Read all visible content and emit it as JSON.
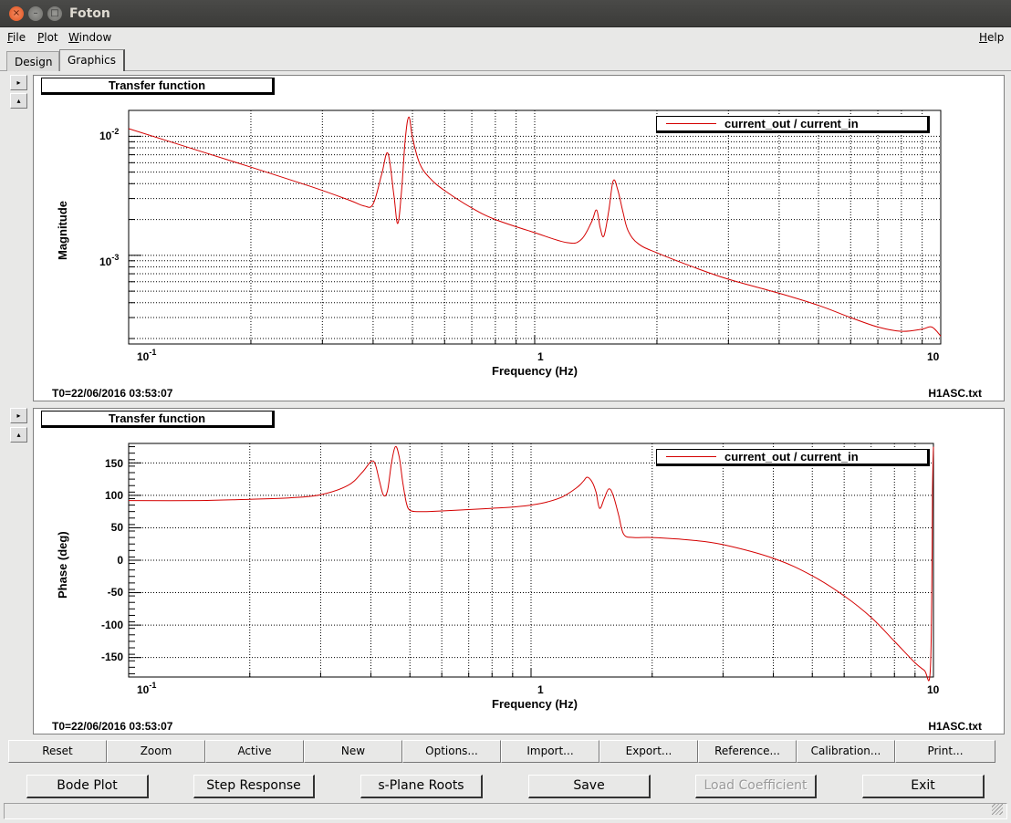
{
  "window": {
    "title": "Foton"
  },
  "menu": {
    "file": {
      "ul": "F",
      "rest": "ile"
    },
    "plot": {
      "ul": "P",
      "rest": "lot"
    },
    "window": {
      "ul": "W",
      "rest": "indow"
    },
    "help": {
      "ul": "H",
      "rest": "elp"
    }
  },
  "tabs": [
    "Design",
    "Graphics"
  ],
  "active_tab": "Graphics",
  "side_buttons": {
    "expand": "▸",
    "collapse": "▴"
  },
  "icons": {
    "close": "×",
    "minimize": "–",
    "maximize": "□"
  },
  "panels": [
    {
      "graph_title": "Transfer function",
      "legend": "current_out / current_in",
      "y_title": "Magnitude",
      "x_title": "Frequency (Hz)",
      "y_ticks": [
        "10",
        "10"
      ],
      "y_tick_exps": [
        "-2",
        "-3"
      ],
      "x_ticks": [
        "10",
        "1",
        "10"
      ],
      "x_tick_exp": "-1",
      "t0": "T0=22/06/2016 03:53:07",
      "file": "H1ASC.txt"
    },
    {
      "graph_title": "Transfer function",
      "legend": "current_out / current_in",
      "y_title": "Phase (deg)",
      "x_title": "Frequency (Hz)",
      "y_ticks": [
        "150",
        "100",
        "50",
        "0",
        "-50",
        "-100",
        "-150"
      ],
      "x_ticks": [
        "10",
        "1",
        "10"
      ],
      "x_tick_exp": "-1",
      "t0": "T0=22/06/2016 03:53:07",
      "file": "H1ASC.txt"
    }
  ],
  "chart_data": [
    {
      "type": "line",
      "title": "Transfer function",
      "xlabel": "Frequency (Hz)",
      "ylabel": "Magnitude",
      "x_scale": "log",
      "y_scale": "log",
      "xlim": [
        0.1,
        10
      ],
      "ylim": [
        0.00018,
        0.0165
      ],
      "grid": true,
      "legend_position": "top-right",
      "series": [
        {
          "name": "current_out / current_in",
          "color": "#d40000",
          "x": [
            0.1,
            0.15,
            0.2,
            0.28,
            0.35,
            0.38,
            0.4,
            0.42,
            0.435,
            0.45,
            0.46,
            0.47,
            0.48,
            0.49,
            0.5,
            0.52,
            0.55,
            0.6,
            0.7,
            0.8,
            1.0,
            1.2,
            1.3,
            1.38,
            1.42,
            1.45,
            1.48,
            1.52,
            1.56,
            1.6,
            1.65,
            1.7,
            1.8,
            2.0,
            2.5,
            3.0,
            4.0,
            5.0,
            6.0,
            7.0,
            8.0,
            9.0,
            9.5,
            10.0
          ],
          "y": [
            0.0116,
            0.0075,
            0.0055,
            0.0038,
            0.0029,
            0.0026,
            0.0027,
            0.0048,
            0.0072,
            0.0032,
            0.00185,
            0.0035,
            0.0095,
            0.0145,
            0.0098,
            0.006,
            0.0045,
            0.0035,
            0.0025,
            0.002,
            0.00155,
            0.00128,
            0.00135,
            0.0019,
            0.0024,
            0.0017,
            0.00145,
            0.0023,
            0.0042,
            0.0036,
            0.0023,
            0.0016,
            0.00125,
            0.00105,
            0.00078,
            0.00063,
            0.00048,
            0.00038,
            0.0003,
            0.00025,
            0.00023,
            0.00024,
            0.00025,
            0.00021
          ]
        }
      ]
    },
    {
      "type": "line",
      "title": "Transfer function",
      "xlabel": "Frequency (Hz)",
      "ylabel": "Phase (deg)",
      "x_scale": "log",
      "xlim": [
        0.1,
        10
      ],
      "ylim": [
        -180,
        180
      ],
      "grid": true,
      "legend_position": "top-right",
      "series": [
        {
          "name": "current_out / current_in",
          "color": "#d40000",
          "x": [
            0.1,
            0.15,
            0.2,
            0.25,
            0.3,
            0.35,
            0.38,
            0.4,
            0.41,
            0.42,
            0.43,
            0.44,
            0.45,
            0.46,
            0.47,
            0.48,
            0.49,
            0.5,
            0.52,
            0.55,
            0.6,
            0.7,
            0.8,
            0.9,
            1.0,
            1.1,
            1.2,
            1.3,
            1.35,
            1.38,
            1.42,
            1.45,
            1.48,
            1.52,
            1.56,
            1.6,
            1.65,
            1.7,
            1.8,
            2.0,
            2.5,
            3.0,
            4.0,
            5.0,
            6.0,
            7.0,
            8.0,
            9.0,
            9.5,
            9.8,
            9.9,
            9.95,
            10.0
          ],
          "y": [
            92,
            92,
            94,
            96,
            101,
            115,
            135,
            152,
            148,
            122,
            100,
            108,
            150,
            175,
            160,
            120,
            88,
            77,
            75,
            75,
            76,
            78,
            80,
            82,
            85,
            90,
            98,
            112,
            122,
            128,
            120,
            105,
            80,
            95,
            110,
            100,
            70,
            40,
            35,
            35,
            31,
            24,
            3,
            -24,
            -55,
            -88,
            -125,
            -158,
            -170,
            -178,
            -60,
            110,
            175
          ]
        }
      ]
    }
  ],
  "toolbar_row": [
    "Reset",
    "Zoom",
    "Active",
    "New",
    "Options...",
    "Import...",
    "Export...",
    "Reference...",
    "Calibration...",
    "Print..."
  ],
  "action_buttons": {
    "bode": "Bode Plot",
    "step": "Step Response",
    "splane": "s-Plane Roots",
    "save": "Save",
    "load": "Load Coefficient",
    "exit": "Exit"
  }
}
